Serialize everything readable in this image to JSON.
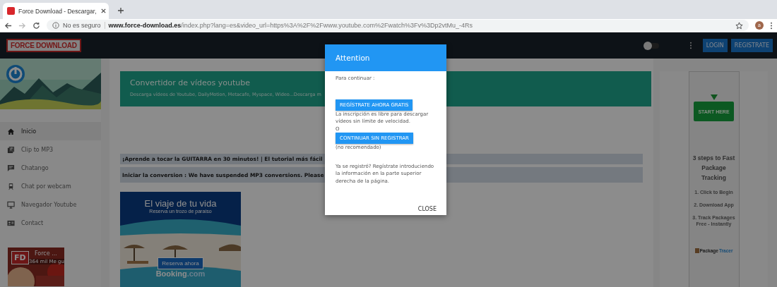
{
  "browser": {
    "tab_title": "Force Download - Descargar, ",
    "security": "No es seguro",
    "url_domain": "www.force-download.es",
    "url_path": "/index.php?lang=es&video_url=https%3A%2F%2Fwww.youtube.com%2Fwatch%3Fv%3Dp2vtMu_-4Rs",
    "avatar": "a"
  },
  "site_header": {
    "logo": "FORCE DOWNLOAD",
    "toggle_on": false,
    "buttons": [
      "LOGIN",
      "REGISTRATE"
    ]
  },
  "sidebar": {
    "items": [
      {
        "label": "Inicio",
        "kind": "home",
        "selected": true
      },
      {
        "label": "Clip to MP3",
        "kind": "clip",
        "selected": false
      },
      {
        "label": "Chatango",
        "kind": "chat",
        "selected": false
      },
      {
        "label": "Chat por webcam",
        "kind": "webcam",
        "selected": false
      },
      {
        "label": "Navegador Youtube",
        "kind": "monitor",
        "selected": false
      },
      {
        "label": "Contact",
        "kind": "contact",
        "selected": false
      }
    ],
    "widget": {
      "badge": "FD",
      "name": "Force ...",
      "likes": "364 mil Me gu"
    }
  },
  "main": {
    "title": "Convertidor de vídeos youtube",
    "subtitle": "Descarga vídeos de Youtube, DailyMotion, Metacafe, Myspace, Wideo...Descarga m",
    "notices": [
      "¡Aprende a tocar la GUITARRA en 30 minutos! | El tutorial más fácil",
      "Iniciar la conversion : We have suspended MP3 conversions. Please"
    ],
    "ad": {
      "kind": "picture",
      "headline": "El viaje de tu vida",
      "tagline": "Reserva un trozo de paraíso",
      "button": "Reserva ahora",
      "brand": "Booking",
      "brand_suffix": ".com"
    }
  },
  "side_ad": {
    "button": "START HERE",
    "heading": "3 steps to Fast Package Tracking",
    "steps": [
      "1. Click to Begin",
      "2. Download App",
      "3. Track Packages Free - Instantly"
    ],
    "logo": "Package",
    "logo_suffix": "Tracer"
  },
  "dialog": {
    "title": "Attention",
    "intro": "Para continuar :",
    "primary_button": "REGÍSTRATE AHORA GRATIS",
    "primary_note": "La inscripción es libre para descargar vídeos sin límite de velocidad.",
    "separator": "O",
    "secondary_button": "CONTINUAR SIN REGISTRAR",
    "secondary_note": "(no recomendado)",
    "footer_note": "Ya se registró? Regístrate introduciendo la información en la parte superior derecha de la página.",
    "close": "CLOSE"
  }
}
